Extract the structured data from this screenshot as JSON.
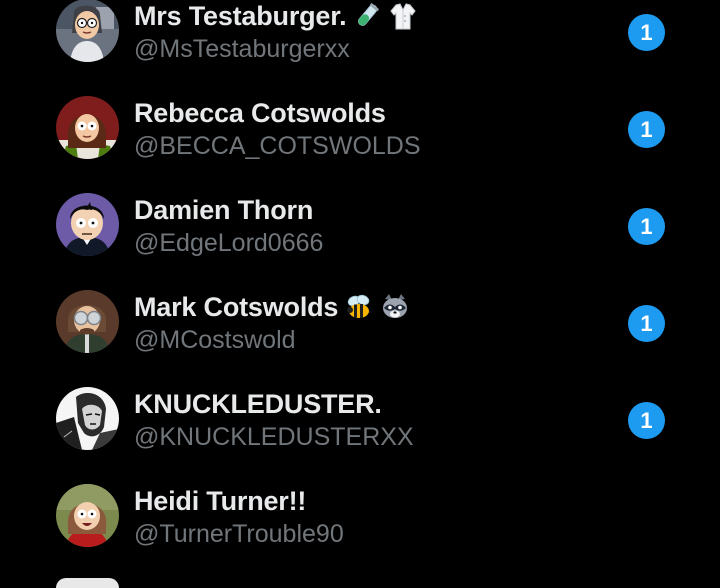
{
  "accent_color": "#1d9bf0",
  "conversations": [
    {
      "name": "Mrs Testaburger.",
      "handle": "@MsTestaburgerxx",
      "emojis": [
        "test-tube-icon",
        "lab-coat-icon"
      ],
      "unread": "1"
    },
    {
      "name": "Rebecca Cotswolds",
      "handle": "@BECCA_COTSWOLDS",
      "emojis": [],
      "unread": "1"
    },
    {
      "name": "Damien Thorn",
      "handle": "@EdgeLord0666",
      "emojis": [],
      "unread": "1"
    },
    {
      "name": "Mark Cotswolds",
      "handle": "@MCostswold",
      "emojis": [
        "bee-icon",
        "raccoon-icon"
      ],
      "unread": "1"
    },
    {
      "name": "KNUCKLEDUSTER.",
      "handle": "@KNUCKLEDUSTERXX",
      "emojis": [],
      "unread": "1"
    },
    {
      "name": "Heidi Turner!!",
      "handle": "@TurnerTrouble90",
      "emojis": [],
      "unread": ""
    }
  ]
}
